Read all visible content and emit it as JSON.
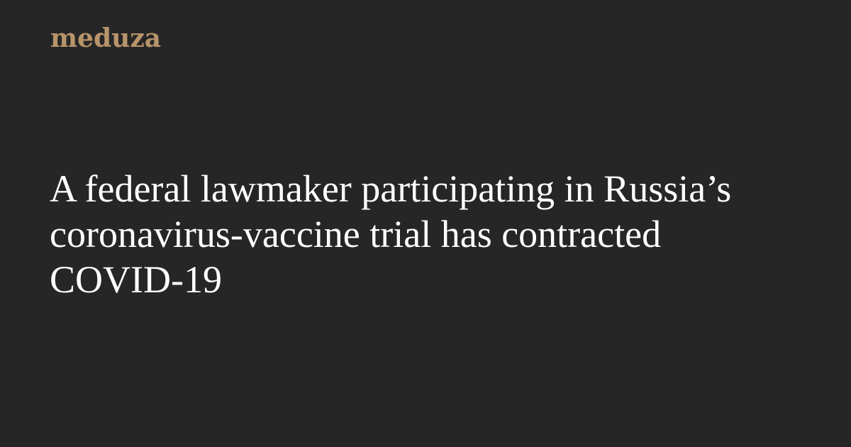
{
  "brand": {
    "name": "meduza",
    "color": "#b8946a"
  },
  "article": {
    "headline": "A federal lawmaker participating in Russia’s coronavirus-vaccine trial has contracted COVID-19"
  },
  "theme": {
    "background": "#262626",
    "text": "#ffffff"
  }
}
